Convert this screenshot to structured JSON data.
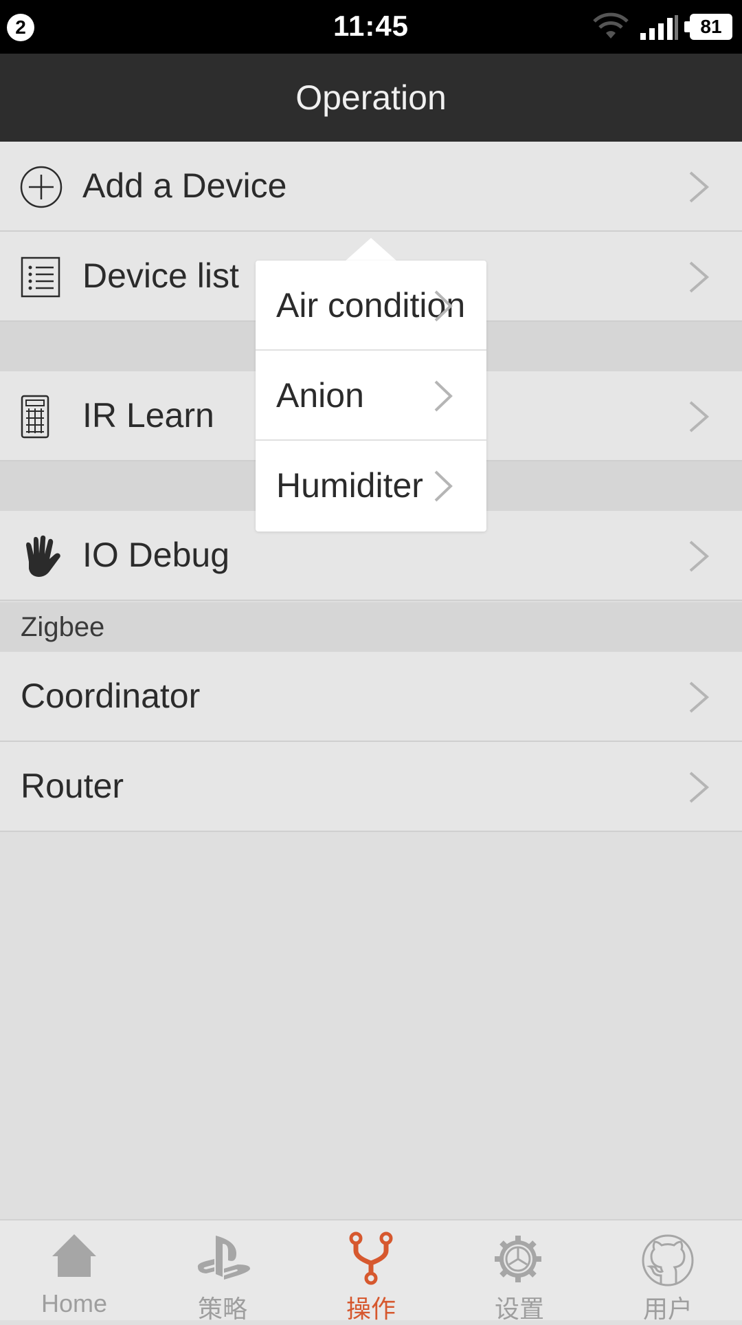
{
  "status_bar": {
    "notification_count": "2",
    "time": "11:45",
    "battery": "81",
    "icons": [
      "wifi-icon",
      "signal-icon",
      "battery-icon"
    ]
  },
  "nav": {
    "title": "Operation"
  },
  "list": {
    "rows": [
      {
        "label": "Add a Device",
        "icon": "plus-circle-icon"
      },
      {
        "label": "Device list",
        "icon": "list-icon"
      },
      {
        "label": "IR Learn",
        "icon": "calculator-icon"
      },
      {
        "label": "IO Debug",
        "icon": "hand-icon"
      }
    ],
    "section_header": "Zigbee",
    "zigbee_rows": [
      {
        "label": "Coordinator"
      },
      {
        "label": "Router"
      }
    ]
  },
  "popover": {
    "items": [
      "Air condition",
      "Anion",
      "Humiditer"
    ]
  },
  "tabbar": {
    "active_index": 2,
    "accent_color": "#d6582e",
    "inactive_color": "#9e9e9e",
    "tabs": [
      {
        "label": "Home",
        "icon": "home-icon"
      },
      {
        "label": "策略",
        "icon": "playstation-icon"
      },
      {
        "label": "操作",
        "icon": "fork-icon"
      },
      {
        "label": "设置",
        "icon": "gear-icon"
      },
      {
        "label": "用户",
        "icon": "github-icon"
      }
    ]
  }
}
